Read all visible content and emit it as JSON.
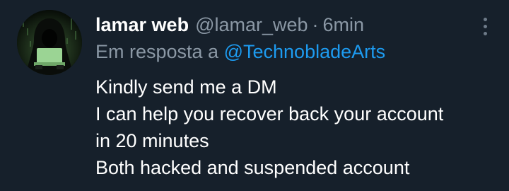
{
  "tweet": {
    "display_name": "lamar web",
    "handle": "@lamar_web",
    "separator": "·",
    "time": "6min",
    "reply_prefix": "Em resposta a",
    "reply_to": "@TechnobladeArts",
    "text_lines": [
      "Kindly send me a DM",
      "I can help you recover back your account",
      "in 20 minutes",
      "Both hacked and suspended account"
    ]
  },
  "icons": {
    "avatar": "hooded-hacker-avatar",
    "menu": "more-options-icon"
  },
  "colors": {
    "background": "#16202b",
    "primary_text": "#ffffff",
    "secondary_text": "#8b98a5",
    "mention": "#1d9bf0",
    "avatar_glow": "#8fd18a"
  }
}
